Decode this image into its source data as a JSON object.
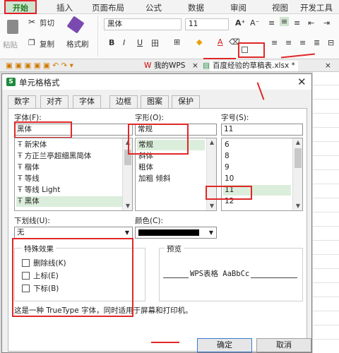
{
  "ribbon": {
    "tabs": [
      "开始",
      "插入",
      "页面布局",
      "公式",
      "数据",
      "审阅",
      "视图",
      "开发工具"
    ],
    "cut": "剪切",
    "copy": "复制",
    "format_painter": "格式刷",
    "paste": "粘贴",
    "font_name": "黑体",
    "font_size": "11",
    "bold": "B",
    "italic": "I",
    "underline": "U",
    "grow_font": "A⁺",
    "shrink_font": "A⁻"
  },
  "doc_tabs": {
    "my_wps": "我的WPS",
    "file": "百度经验的草稿表.xlsx *"
  },
  "dialog": {
    "title": "单元格格式",
    "tabs": [
      "数字",
      "对齐",
      "字体",
      "边框",
      "图案",
      "保护"
    ],
    "active_tab": "字体",
    "font_label": "字体(F):",
    "font_value": "黑体",
    "font_list": [
      "新宋体",
      "方正兰亭超细黑简体",
      "楷体",
      "等线",
      "等线 Light",
      "黑体"
    ],
    "style_label": "字形(O):",
    "style_value": "常规",
    "style_list": [
      "常规",
      "斜体",
      "粗体",
      "加粗 倾斜"
    ],
    "size_label": "字号(S):",
    "size_value": "11",
    "size_list": [
      "6",
      "8",
      "9",
      "10",
      "11",
      "12"
    ],
    "underline_label": "下划线(U):",
    "underline_value": "无",
    "color_label": "颜色(C):",
    "effects_label": "特殊效果",
    "strikethrough": "删除线(K)",
    "superscript": "上标(E)",
    "subscript": "下标(B)",
    "preview_label": "预览",
    "preview_text": "WPS表格  AaBbCc",
    "note": "这是一种 TrueType 字体，同时适用于屏幕和打印机。",
    "ok": "确定",
    "cancel": "取消"
  },
  "colors": {
    "accent_green": "#1e7a1e",
    "annotation_red": "#e02828",
    "selection": "#dbeedb"
  }
}
